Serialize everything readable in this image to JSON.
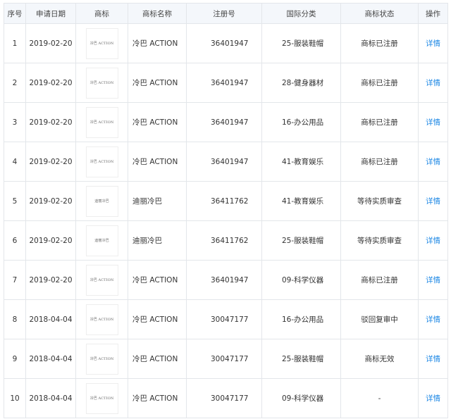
{
  "columns": [
    "序号",
    "申请日期",
    "商标",
    "商标名称",
    "注册号",
    "国际分类",
    "商标状态",
    "操作"
  ],
  "rows": [
    {
      "no": "1",
      "date": "2019-02-20",
      "logo_text": "冷巴 ACTION",
      "name": "冷巴 ACTION",
      "reg_no": "36401947",
      "class": "25-服装鞋帽",
      "status": "商标已注册",
      "action": "详情"
    },
    {
      "no": "2",
      "date": "2019-02-20",
      "logo_text": "冷巴 ACTION",
      "name": "冷巴 ACTION",
      "reg_no": "36401947",
      "class": "28-健身器材",
      "status": "商标已注册",
      "action": "详情"
    },
    {
      "no": "3",
      "date": "2019-02-20",
      "logo_text": "冷巴 ACTION",
      "name": "冷巴 ACTION",
      "reg_no": "36401947",
      "class": "16-办公用品",
      "status": "商标已注册",
      "action": "详情"
    },
    {
      "no": "4",
      "date": "2019-02-20",
      "logo_text": "冷巴 ACTION",
      "name": "冷巴 ACTION",
      "reg_no": "36401947",
      "class": "41-教育娱乐",
      "status": "商标已注册",
      "action": "详情"
    },
    {
      "no": "5",
      "date": "2019-02-20",
      "logo_text": "迪丽冷巴",
      "name": "迪丽冷巴",
      "reg_no": "36411762",
      "class": "41-教育娱乐",
      "status": "等待实质审查",
      "action": "详情"
    },
    {
      "no": "6",
      "date": "2019-02-20",
      "logo_text": "迪丽冷巴",
      "name": "迪丽冷巴",
      "reg_no": "36411762",
      "class": "25-服装鞋帽",
      "status": "等待实质审查",
      "action": "详情"
    },
    {
      "no": "7",
      "date": "2019-02-20",
      "logo_text": "冷巴 ACTION",
      "name": "冷巴 ACTION",
      "reg_no": "36401947",
      "class": "09-科学仪器",
      "status": "商标已注册",
      "action": "详情"
    },
    {
      "no": "8",
      "date": "2018-04-04",
      "logo_text": "冷巴 ACTION",
      "name": "冷巴 ACTION",
      "reg_no": "30047177",
      "class": "16-办公用品",
      "status": "驳回复审中",
      "action": "详情"
    },
    {
      "no": "9",
      "date": "2018-04-04",
      "logo_text": "冷巴 ACTION",
      "name": "冷巴 ACTION",
      "reg_no": "30047177",
      "class": "25-服装鞋帽",
      "status": "商标无效",
      "action": "详情"
    },
    {
      "no": "10",
      "date": "2018-04-04",
      "logo_text": "冷巴 ACTION",
      "name": "冷巴 ACTION",
      "reg_no": "30047177",
      "class": "09-科学仪器",
      "status": "-",
      "action": "详情"
    }
  ],
  "colors": {
    "link": "#1e88e5",
    "header_bg": "#f4f7fb",
    "border": "#e3e6ea"
  }
}
